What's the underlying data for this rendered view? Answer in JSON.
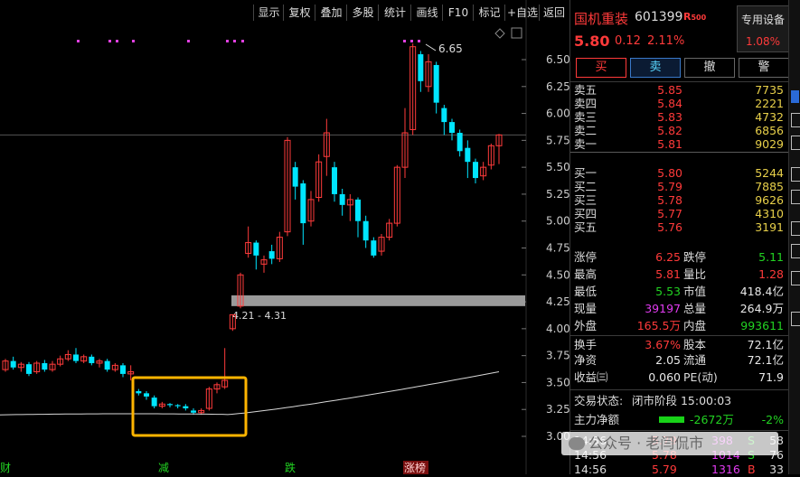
{
  "toolbar": [
    "显示",
    "复权",
    "叠加",
    "多股",
    "统计",
    "画线",
    "F10",
    "标记",
    "+自选",
    "返回"
  ],
  "stock": {
    "name": "国机重装",
    "code": "601399",
    "tag": "R",
    "tag_sub": "500",
    "price": "5.80",
    "change": "0.12",
    "pct": "2.11%",
    "sector": "专用设备",
    "sector_pct": "1.08%"
  },
  "buttons": [
    "买",
    "卖",
    "撤",
    "警"
  ],
  "asks": [
    {
      "label": "卖五",
      "price": "5.85",
      "vol": "7735"
    },
    {
      "label": "卖四",
      "price": "5.84",
      "vol": "2221"
    },
    {
      "label": "卖三",
      "price": "5.83",
      "vol": "4732"
    },
    {
      "label": "卖二",
      "price": "5.82",
      "vol": "6856"
    },
    {
      "label": "卖一",
      "price": "5.81",
      "vol": "9029"
    }
  ],
  "bids": [
    {
      "label": "买一",
      "price": "5.80",
      "vol": "5244"
    },
    {
      "label": "买二",
      "price": "5.79",
      "vol": "7885"
    },
    {
      "label": "买三",
      "price": "5.78",
      "vol": "9626"
    },
    {
      "label": "买四",
      "price": "5.77",
      "vol": "4310"
    },
    {
      "label": "买五",
      "price": "5.76",
      "vol": "3191"
    }
  ],
  "stats": [
    {
      "l1": "涨停",
      "v1": "6.25",
      "l2": "跌停",
      "v2": "5.11"
    },
    {
      "l1": "最高",
      "v1": "5.81",
      "l2": "量比",
      "v2": "1.28"
    },
    {
      "l1": "最低",
      "v1": "5.53",
      "l2": "市值",
      "v2": "418.4亿"
    },
    {
      "l1": "现量",
      "v1": "39197",
      "l2": "总量",
      "v2": "264.9万"
    },
    {
      "l1": "外盘",
      "v1": "165.5万",
      "l2": "内盘",
      "v2": "993611"
    },
    {
      "l1": "换手",
      "v1": "3.67%",
      "l2": "股本",
      "v2": "72.1亿"
    },
    {
      "l1": "净资",
      "v1": "2.05",
      "l2": "流通",
      "v2": "72.1亿"
    },
    {
      "l1": "收益㈢",
      "v1": "0.060",
      "l2": "PE(动)",
      "v2": "71.9"
    }
  ],
  "status": {
    "label": "交易状态:",
    "value": "闭市阶段 15:00:03"
  },
  "flow": {
    "label": "主力净额",
    "value": "-2672万",
    "pct": "-2%"
  },
  "ticks": [
    {
      "time": "14:56",
      "price": "5.79",
      "vol": "398",
      "side": "S",
      "x": "58"
    },
    {
      "time": "14:56",
      "price": "5.78",
      "vol": "1014",
      "side": "S",
      "x": "76"
    },
    {
      "time": "14:56",
      "price": "5.79",
      "vol": "1316",
      "side": "B",
      "x": "33"
    }
  ],
  "watermark": "公众号 · 老闫侃市",
  "chart_data": {
    "type": "candlestick",
    "y_ticks": [
      "6.50",
      "6.25",
      "6.00",
      "5.75",
      "5.50",
      "5.25",
      "5.00",
      "4.75",
      "4.50",
      "4.25",
      "4.00",
      "3.75",
      "3.50",
      "3.25",
      "3.00"
    ],
    "ylim": [
      2.98,
      6.72
    ],
    "annotation_high": "6.65",
    "gap_label": "4.21 - 4.31",
    "bottom_labels": [
      "财",
      "减",
      "跌",
      "涨榜"
    ],
    "candles": [
      [
        3.62,
        3.7,
        3.6,
        3.72
      ],
      [
        3.7,
        3.64,
        3.62,
        3.74
      ],
      [
        3.64,
        3.67,
        3.6,
        3.69
      ],
      [
        3.67,
        3.58,
        3.56,
        3.69
      ],
      [
        3.6,
        3.68,
        3.58,
        3.7
      ],
      [
        3.68,
        3.62,
        3.6,
        3.71
      ],
      [
        3.62,
        3.67,
        3.6,
        3.7
      ],
      [
        3.67,
        3.72,
        3.65,
        3.75
      ],
      [
        3.72,
        3.76,
        3.7,
        3.8
      ],
      [
        3.76,
        3.7,
        3.68,
        3.82
      ],
      [
        3.7,
        3.74,
        3.68,
        3.76
      ],
      [
        3.74,
        3.68,
        3.66,
        3.76
      ],
      [
        3.68,
        3.7,
        3.64,
        3.72
      ],
      [
        3.7,
        3.62,
        3.6,
        3.72
      ],
      [
        3.62,
        3.66,
        3.6,
        3.68
      ],
      [
        3.66,
        3.58,
        3.55,
        3.68
      ],
      [
        3.58,
        3.6,
        3.52,
        3.66
      ],
      [
        3.42,
        3.4,
        3.38,
        3.44
      ],
      [
        3.4,
        3.37,
        3.34,
        3.42
      ],
      [
        3.36,
        3.28,
        3.26,
        3.38
      ],
      [
        3.28,
        3.3,
        3.26,
        3.32
      ],
      [
        3.3,
        3.29,
        3.27,
        3.31
      ],
      [
        3.29,
        3.28,
        3.26,
        3.3
      ],
      [
        3.28,
        3.26,
        3.24,
        3.3
      ],
      [
        3.24,
        3.22,
        3.2,
        3.26
      ],
      [
        3.22,
        3.24,
        3.2,
        3.26
      ],
      [
        3.26,
        3.44,
        3.24,
        3.46
      ],
      [
        3.44,
        3.48,
        3.4,
        3.5
      ],
      [
        3.46,
        3.52,
        3.44,
        3.82
      ],
      [
        4.0,
        4.13,
        3.98,
        4.13
      ],
      [
        4.21,
        4.5,
        4.19,
        4.52
      ],
      [
        4.7,
        4.8,
        4.66,
        4.95
      ],
      [
        4.8,
        4.68,
        4.55,
        4.82
      ],
      [
        4.6,
        4.64,
        4.52,
        4.68
      ],
      [
        4.72,
        4.65,
        4.6,
        4.78
      ],
      [
        4.65,
        4.85,
        4.62,
        4.9
      ],
      [
        4.9,
        5.75,
        4.86,
        5.78
      ],
      [
        5.5,
        5.32,
        5.2,
        5.55
      ],
      [
        5.35,
        4.98,
        4.78,
        5.38
      ],
      [
        5.0,
        5.2,
        4.95,
        5.28
      ],
      [
        5.22,
        5.55,
        5.18,
        5.62
      ],
      [
        5.6,
        5.82,
        5.42,
        5.95
      ],
      [
        5.5,
        5.25,
        5.18,
        5.55
      ],
      [
        5.25,
        5.15,
        5.05,
        5.3
      ],
      [
        5.15,
        5.2,
        5.0,
        5.25
      ],
      [
        5.2,
        5.0,
        4.85,
        5.22
      ],
      [
        5.0,
        4.82,
        4.75,
        5.05
      ],
      [
        4.82,
        4.68,
        4.66,
        4.85
      ],
      [
        4.72,
        4.85,
        4.68,
        4.88
      ],
      [
        4.85,
        4.98,
        4.82,
        5.02
      ],
      [
        4.98,
        5.5,
        4.95,
        5.52
      ],
      [
        5.5,
        5.82,
        5.4,
        6.05
      ],
      [
        5.85,
        6.62,
        5.8,
        6.65
      ],
      [
        6.55,
        6.3,
        6.2,
        6.58
      ],
      [
        6.25,
        6.48,
        6.2,
        6.55
      ],
      [
        6.45,
        6.1,
        6.0,
        6.48
      ],
      [
        6.05,
        5.92,
        5.8,
        6.08
      ],
      [
        5.92,
        5.82,
        5.75,
        5.95
      ],
      [
        5.82,
        5.65,
        5.6,
        5.85
      ],
      [
        5.68,
        5.55,
        5.4,
        5.75
      ],
      [
        5.55,
        5.4,
        5.35,
        5.58
      ],
      [
        5.42,
        5.5,
        5.38,
        5.55
      ],
      [
        5.52,
        5.7,
        5.48,
        5.72
      ],
      [
        5.7,
        5.8,
        5.53,
        5.81
      ]
    ],
    "ma_start": 3.2,
    "ma_end": 3.6
  },
  "colors": {
    "up": "#ff3b3b",
    "down": "#00e5ff",
    "ma": "#d8d8d8",
    "highlight": "#ffb400",
    "gap": "#9a9a9a"
  }
}
